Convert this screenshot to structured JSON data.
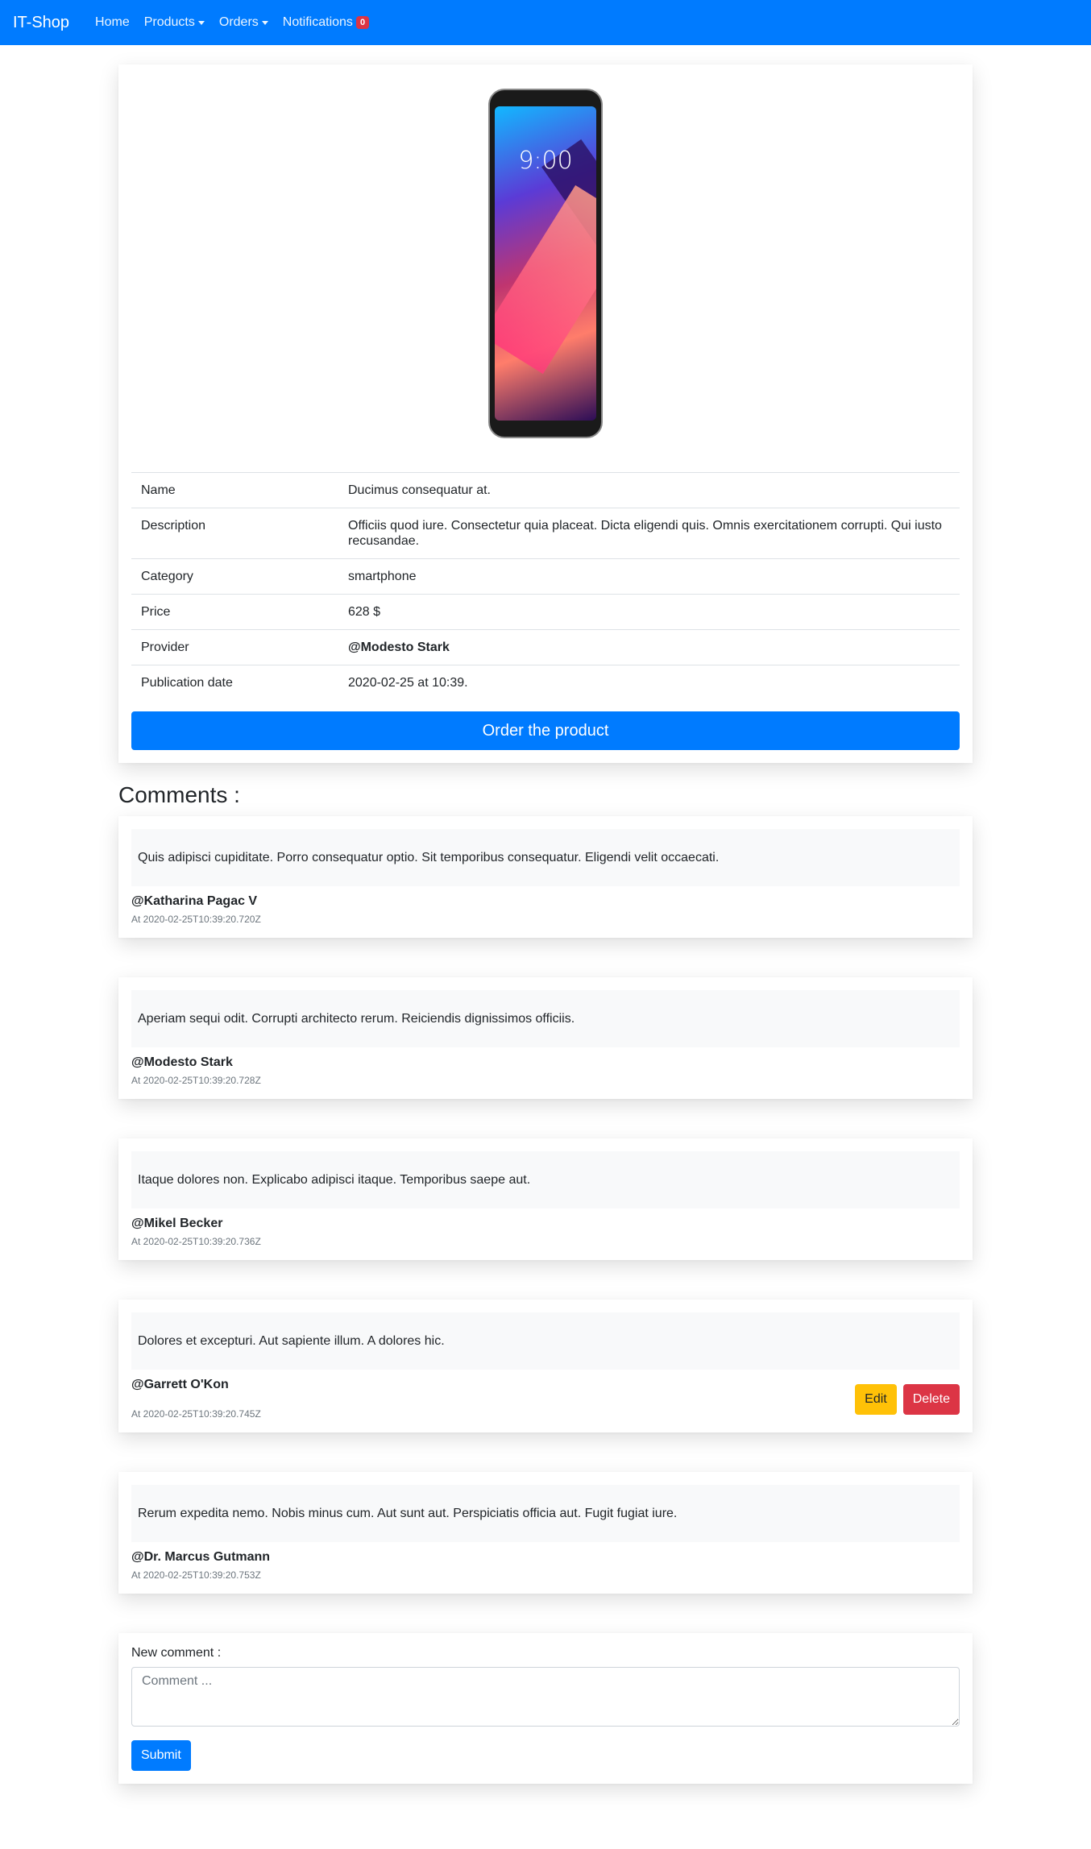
{
  "nav": {
    "brand": "IT-Shop",
    "home": "Home",
    "products": "Products",
    "orders": "Orders",
    "notifications": "Notifications",
    "notifications_count": "0"
  },
  "product": {
    "image_alt": "smartphone image",
    "screen_time": "9:00",
    "rows": [
      {
        "label": "Name",
        "value": "Ducimus consequatur at."
      },
      {
        "label": "Description",
        "value": "Officiis quod iure. Consectetur quia placeat. Dicta eligendi quis. Omnis exercitationem corrupti. Qui iusto recusandae."
      },
      {
        "label": "Category",
        "value": "smartphone"
      },
      {
        "label": "Price",
        "value": "628 $"
      },
      {
        "label": "Provider",
        "value": "@Modesto Stark"
      },
      {
        "label": "Publication date",
        "value": "2020-02-25 at 10:39."
      }
    ],
    "order_button": "Order the product"
  },
  "comments": {
    "heading": "Comments :",
    "items": [
      {
        "text": "Quis adipisci cupiditate. Porro consequatur optio. Sit temporibus consequatur. Eligendi velit occaecati.",
        "author": "@Katharina Pagac V",
        "date": "At 2020-02-25T10:39:20.720Z"
      },
      {
        "text": "Aperiam sequi odit. Corrupti architecto rerum. Reiciendis dignissimos officiis.",
        "author": "@Modesto Stark",
        "date": "At 2020-02-25T10:39:20.728Z"
      },
      {
        "text": "Itaque dolores non. Explicabo adipisci itaque. Temporibus saepe aut.",
        "author": "@Mikel Becker",
        "date": "At 2020-02-25T10:39:20.736Z"
      },
      {
        "text": "Dolores et excepturi. Aut sapiente illum. A dolores hic.",
        "author": "@Garrett O'Kon",
        "date": "At 2020-02-25T10:39:20.745Z",
        "edit": "Edit",
        "delete": "Delete"
      },
      {
        "text": "Rerum expedita nemo. Nobis minus cum. Aut sunt aut. Perspiciatis officia aut. Fugit fugiat iure.",
        "author": "@Dr. Marcus Gutmann",
        "date": "At 2020-02-25T10:39:20.753Z"
      }
    ]
  },
  "new_comment": {
    "label": "New comment :",
    "placeholder": "Comment ...",
    "value": "",
    "submit": "Submit"
  },
  "colors": {
    "primary": "#007bff",
    "danger": "#dc3545",
    "warning": "#ffc107"
  }
}
